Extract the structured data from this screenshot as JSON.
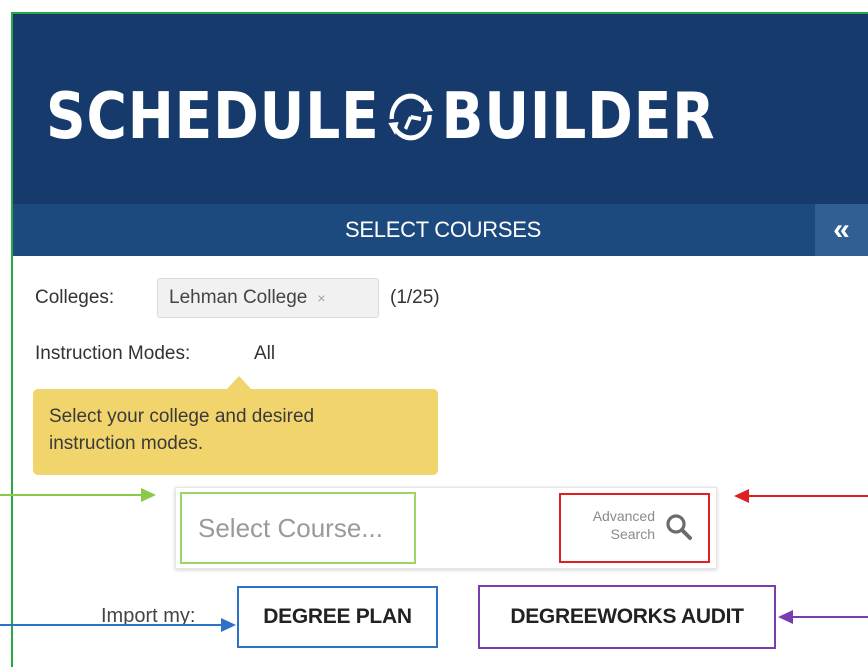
{
  "header": {
    "logo_left": "SCHEDULE",
    "logo_right": "BUILDER",
    "brand_color": "#153a6b"
  },
  "subbar": {
    "title": "SELECT COURSES",
    "collapse_icon": "double-chevron-left-icon",
    "collapse_glyph": "«"
  },
  "filters": {
    "colleges_label": "Colleges:",
    "college_chip": "Lehman College",
    "chip_remove_glyph": "×",
    "college_count": "(1/25)",
    "modes_label": "Instruction Modes:",
    "modes_value": "All"
  },
  "tooltip": {
    "line1": "Select your college and desired",
    "line2": "instruction modes."
  },
  "search": {
    "placeholder": "Select Course...",
    "advanced_line1": "Advanced",
    "advanced_line2": "Search",
    "advanced_icon": "magnifier-icon"
  },
  "import": {
    "label": "Import my:",
    "degree_plan": "DEGREE PLAN",
    "degreeworks_audit": "DEGREEWORKS AUDIT"
  },
  "annotation_colors": {
    "green": "#27a844",
    "light_green": "#9cd46a",
    "red": "#e02020",
    "blue": "#2e72c8",
    "purple": "#7a3db0"
  }
}
